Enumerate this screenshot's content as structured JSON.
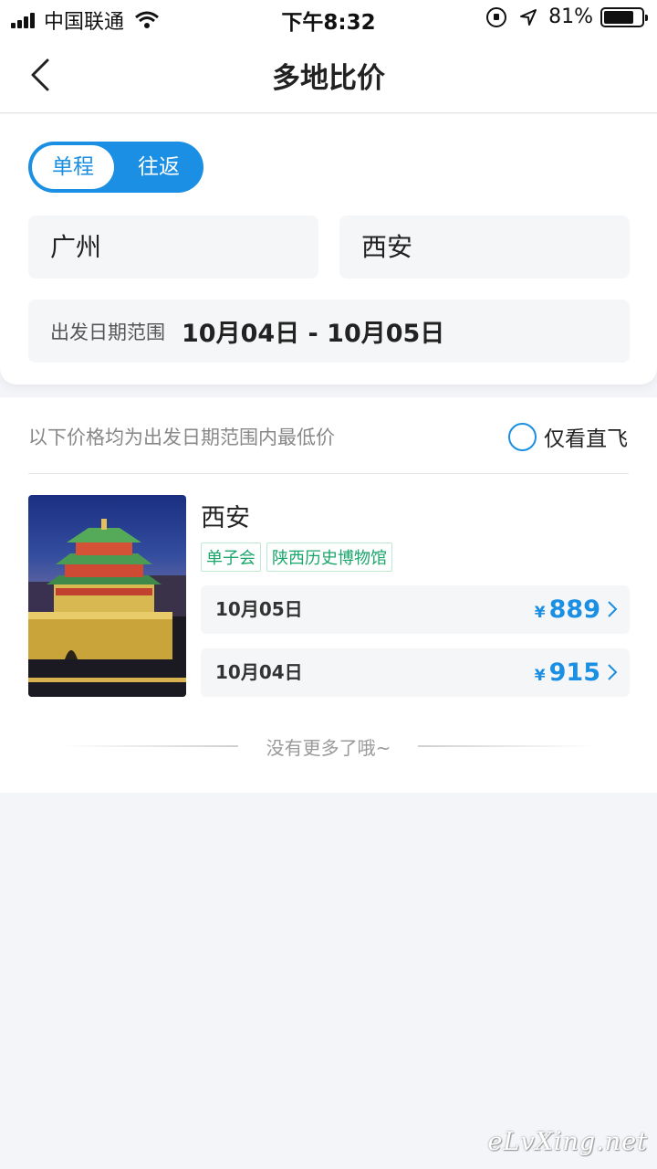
{
  "status_bar": {
    "carrier": "中国联通",
    "time": "下午8:32",
    "battery": "81%",
    "battery_level": 0.81
  },
  "nav": {
    "title": "多地比价"
  },
  "search": {
    "trip_types": [
      "单程",
      "往返"
    ],
    "selected_trip_type": "单程",
    "from_city": "广州",
    "to_city": "西安",
    "date_label": "出发日期范围",
    "date_range": "10月04日 - 10月05日"
  },
  "results": {
    "hint": "以下价格均为出发日期范围内最低价",
    "direct_only_label": "仅看直飞",
    "destinations": [
      {
        "name": "西安",
        "tags": [
          "单子会",
          "陕西历史博物馆"
        ],
        "fares": [
          {
            "date": "10月05日",
            "currency": "¥",
            "price": "889"
          },
          {
            "date": "10月04日",
            "currency": "¥",
            "price": "915"
          }
        ]
      }
    ],
    "end_text": "没有更多了哦~"
  },
  "watermark": "eLvXing.net",
  "colors": {
    "accent": "#1a8fe3",
    "tag_green": "#1aa66b",
    "background": "#f3f5f9"
  }
}
